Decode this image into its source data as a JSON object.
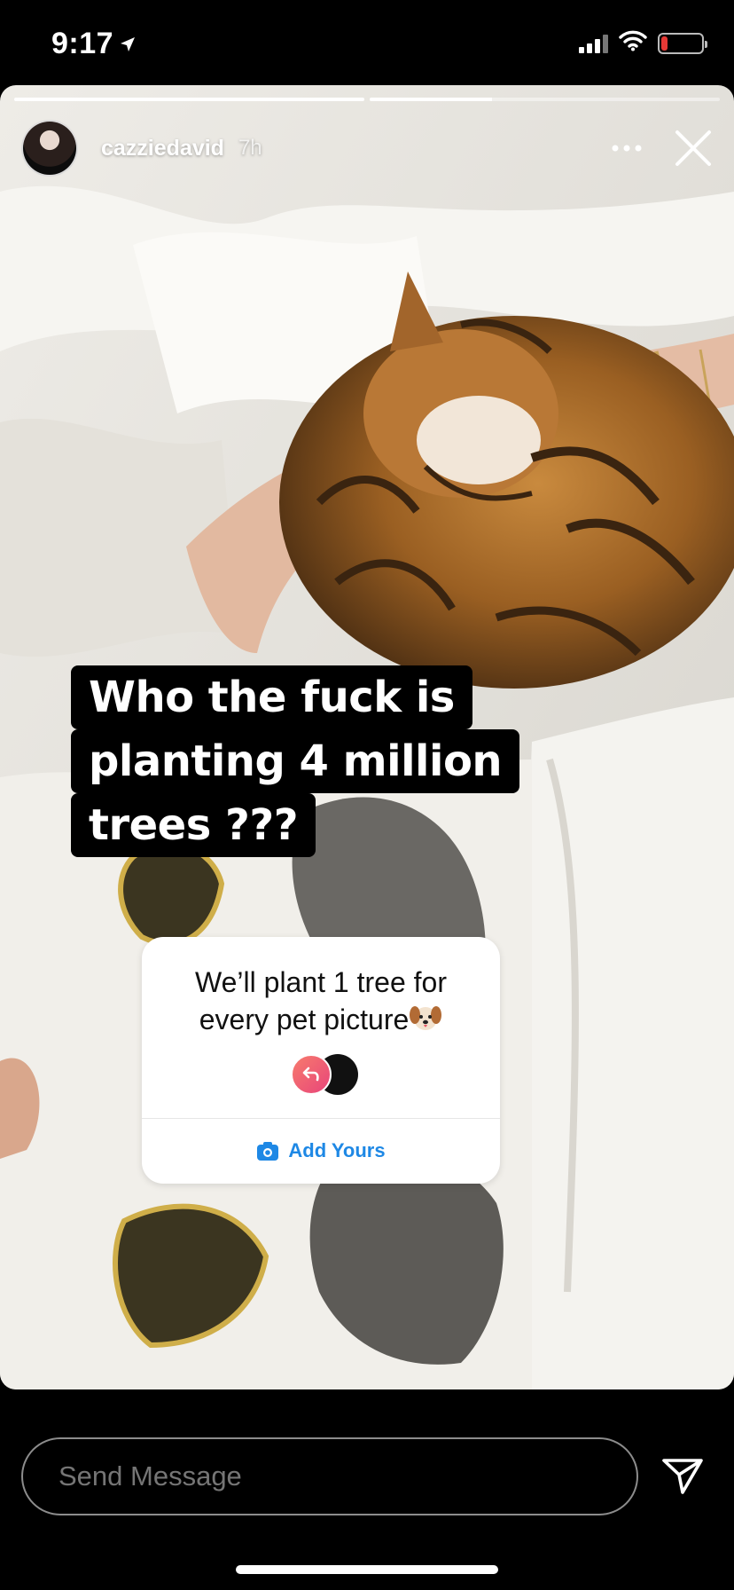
{
  "status_bar": {
    "time": "9:17",
    "location_icon": "location-arrow-icon",
    "signal_icon": "cellular-signal-icon",
    "wifi_icon": "wifi-icon",
    "battery_icon": "battery-low-icon",
    "battery_level": 0.15,
    "battery_color": "#e53935"
  },
  "story": {
    "progress": [
      1.0,
      0.35
    ],
    "username": "cazziedavid",
    "posted_ago": "7h",
    "caption_lines": [
      "Who the fuck is",
      "planting 4 million",
      "trees ???"
    ],
    "caption_bg": "#000000"
  },
  "sticker": {
    "prompt": "We’ll plant 1 tree for every pet picture",
    "emoji": "dog-face-icon",
    "button_label": "Add Yours",
    "accent": "#1e88e5"
  },
  "reply": {
    "placeholder": "Send Message",
    "send_icon": "send-paper-plane-icon"
  }
}
